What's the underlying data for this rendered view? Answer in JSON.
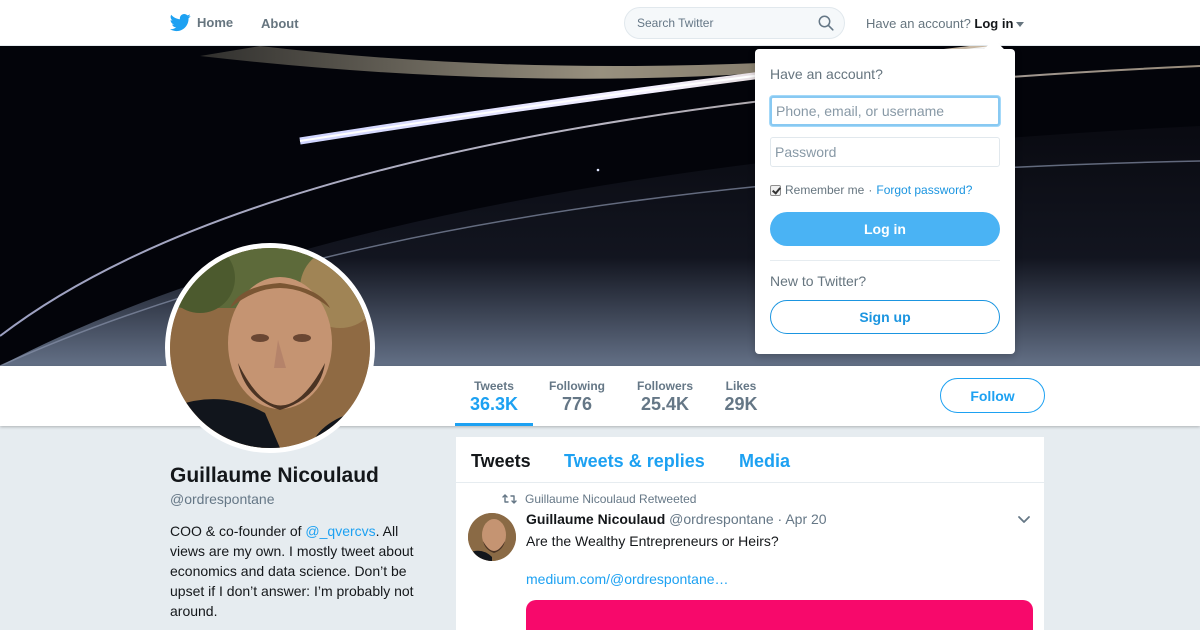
{
  "topbar": {
    "home_label": "Home",
    "about_label": "About",
    "search_placeholder": "Search Twitter",
    "have_account_text": "Have an account?",
    "login_label": "Log in"
  },
  "profile_nav": {
    "stats": [
      {
        "label": "Tweets",
        "value": "36.3K"
      },
      {
        "label": "Following",
        "value": "776"
      },
      {
        "label": "Followers",
        "value": "25.4K"
      },
      {
        "label": "Likes",
        "value": "29K"
      }
    ],
    "follow_label": "Follow"
  },
  "profile": {
    "name": "Guillaume Nicoulaud",
    "handle": "@ordrespontane",
    "bio_before": "COO & co-founder of ",
    "bio_link": "@_qvercvs",
    "bio_after": ". All views are my own. I mostly tweet about economics and data science. Don’t be upset if I don’t answer: I’m probably not around."
  },
  "timeline": {
    "tabs": [
      "Tweets",
      "Tweets & replies",
      "Media"
    ],
    "tweet": {
      "retweet_context": "Guillaume Nicoulaud Retweeted",
      "author_name": "Guillaume Nicoulaud",
      "author_handle": "@ordrespontane",
      "date": "· Apr 20",
      "text": "Are the Wealthy Entrepreneurs or Heirs?",
      "link": "medium.com/@ordrespontane…"
    }
  },
  "login_dropdown": {
    "title": "Have an account?",
    "username_placeholder": "Phone, email, or username",
    "password_placeholder": "Password",
    "remember_label": "Remember me",
    "separator": "·",
    "forgot_label": "Forgot password?",
    "login_button": "Log in",
    "new_text": "New to Twitter?",
    "signup_button": "Sign up"
  },
  "colors": {
    "accent": "#1da1f2",
    "card": "#f7096b"
  }
}
